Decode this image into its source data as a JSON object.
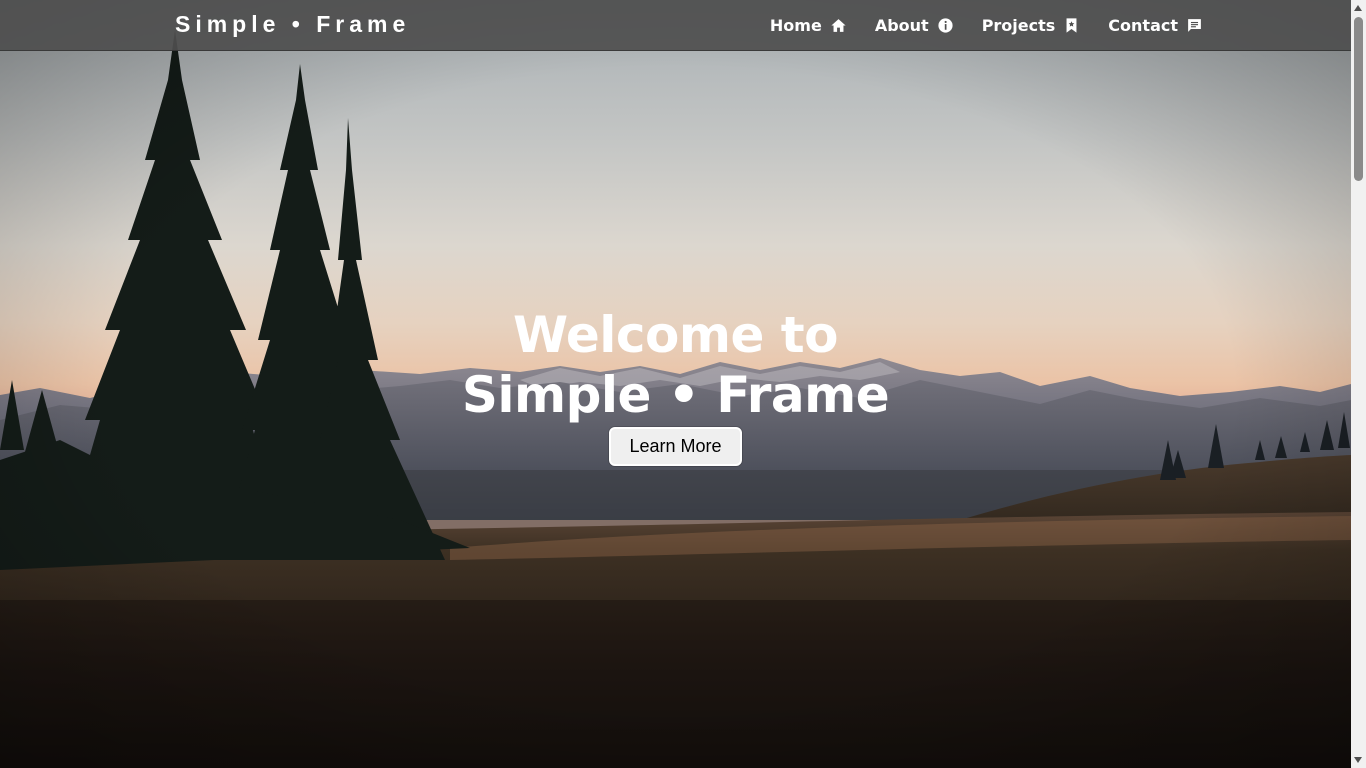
{
  "site": {
    "brand": "Simple • Frame"
  },
  "nav": {
    "items": [
      {
        "label": "Home",
        "icon": "home-icon"
      },
      {
        "label": "About",
        "icon": "info-icon"
      },
      {
        "label": "Projects",
        "icon": "bookmark-icon"
      },
      {
        "label": "Contact",
        "icon": "chat-icon"
      }
    ]
  },
  "hero": {
    "title_line1": "Welcome to",
    "title_line2": "Simple • Frame",
    "button_label": "Learn More",
    "background": "mountain-meadow-sunset-photo"
  },
  "colors": {
    "navbar_bg": "#4e4e4e",
    "nav_text": "#ffffff",
    "button_bg": "#efefef",
    "button_text": "#000000"
  }
}
